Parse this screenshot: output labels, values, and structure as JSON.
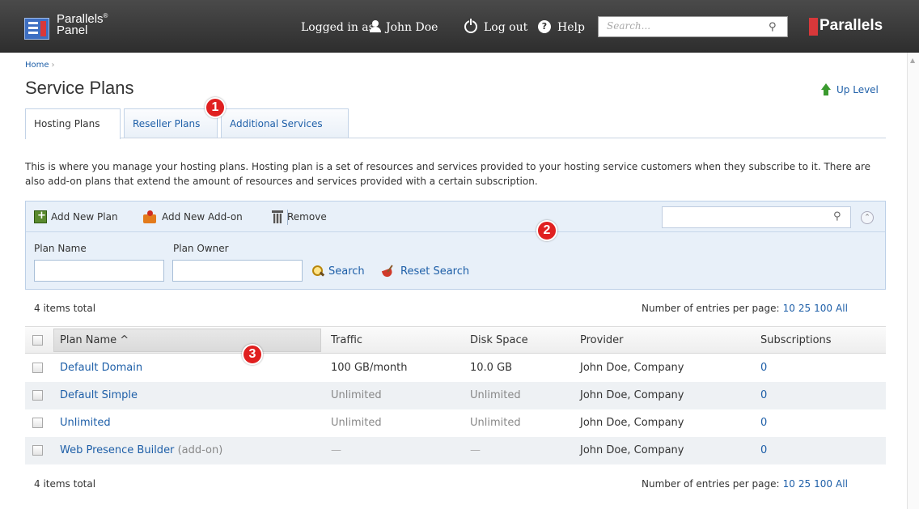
{
  "header": {
    "brand_line1": "Parallels",
    "brand_reg": "®",
    "brand_line2": "Panel",
    "logged_in_as": "Logged in as",
    "user_name": "John Doe",
    "logout": "Log out",
    "help": "Help",
    "search_placeholder": "Search...",
    "brand_logo": "Parallels"
  },
  "breadcrumb": {
    "home": "Home",
    "separator": "›"
  },
  "page": {
    "title": "Service Plans",
    "up_level": "Up Level"
  },
  "tabs": [
    {
      "label": "Hosting Plans",
      "active": true
    },
    {
      "label": "Reseller Plans",
      "active": false
    },
    {
      "label": "Additional Services",
      "active": false
    }
  ],
  "badges": [
    "1",
    "2",
    "3"
  ],
  "description": "This is where you manage your hosting plans. Hosting plan is a set of resources and services provided to your hosting service customers when they subscribe to it. There are also add-on plans that extend the amount of resources and services provided with a certain subscription.",
  "toolbar": {
    "add_plan": "Add New Plan",
    "add_addon": "Add New Add-on",
    "remove": "Remove",
    "search_value": "",
    "collapse": "⌃"
  },
  "filter": {
    "plan_name_label": "Plan Name",
    "plan_owner_label": "Plan Owner",
    "plan_name_value": "",
    "plan_owner_value": "",
    "search": "Search",
    "reset": "Reset Search"
  },
  "pager": {
    "items_total": "4 items total",
    "per_page_label": "Number of entries per page:",
    "options": [
      "10",
      "25",
      "100",
      "All"
    ]
  },
  "table": {
    "columns": [
      "Plan Name",
      "Traffic",
      "Disk Space",
      "Provider",
      "Subscriptions"
    ],
    "sort_arrow": "^",
    "rows": [
      {
        "name": "Default Domain",
        "suffix": "",
        "traffic": "100 GB/month",
        "disk": "10.0 GB",
        "provider": "John Doe, Company",
        "subs": "0"
      },
      {
        "name": "Default Simple",
        "suffix": "",
        "traffic": "Unlimited",
        "disk": "Unlimited",
        "provider": "John Doe, Company",
        "subs": "0"
      },
      {
        "name": "Unlimited",
        "suffix": "",
        "traffic": "Unlimited",
        "disk": "Unlimited",
        "provider": "John Doe, Company",
        "subs": "0"
      },
      {
        "name": "Web Presence Builder",
        "suffix": "(add-on)",
        "traffic": "—",
        "disk": "—",
        "provider": "John Doe, Company",
        "subs": "0"
      }
    ]
  },
  "colors": {
    "link": "#1e5fa8",
    "badge": "#e02020",
    "header": "#3a3a3a",
    "panel": "#e8f0f9"
  }
}
